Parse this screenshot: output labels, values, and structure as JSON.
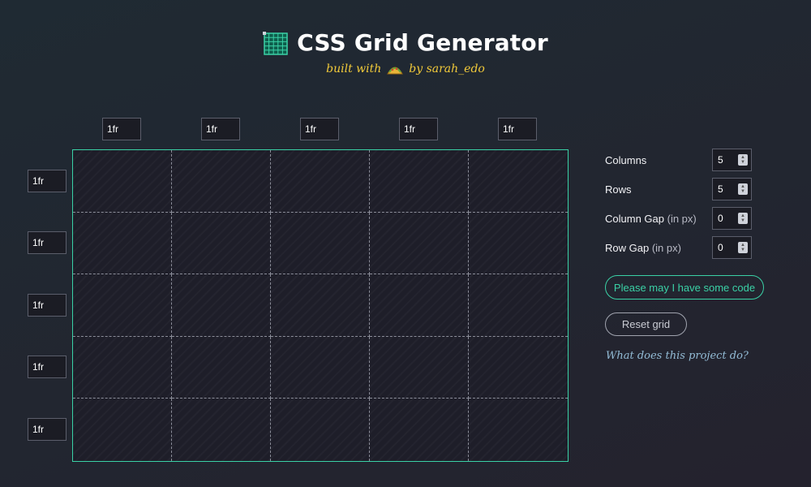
{
  "header": {
    "title": "CSS Grid Generator",
    "subtitle_prefix": "built with",
    "subtitle_suffix": "by sarah_edo",
    "title_icon": "grid-icon",
    "subtitle_icon": "taco-icon"
  },
  "column_units": [
    "1fr",
    "1fr",
    "1fr",
    "1fr",
    "1fr"
  ],
  "row_units": [
    "1fr",
    "1fr",
    "1fr",
    "1fr",
    "1fr"
  ],
  "controls": {
    "columns": {
      "label": "Columns",
      "value": "5"
    },
    "rows": {
      "label": "Rows",
      "value": "5"
    },
    "column_gap": {
      "label": "Column Gap",
      "hint": "(in px)",
      "value": "0"
    },
    "row_gap": {
      "label": "Row Gap",
      "hint": "(in px)",
      "value": "0"
    }
  },
  "buttons": {
    "code": "Please may I have some code",
    "reset": "Reset grid"
  },
  "project_link": "What does this project do?",
  "colors": {
    "accent": "#3ad1a6",
    "subtitle": "#f0c93a",
    "link": "#93bcd6",
    "background": "#222630"
  }
}
